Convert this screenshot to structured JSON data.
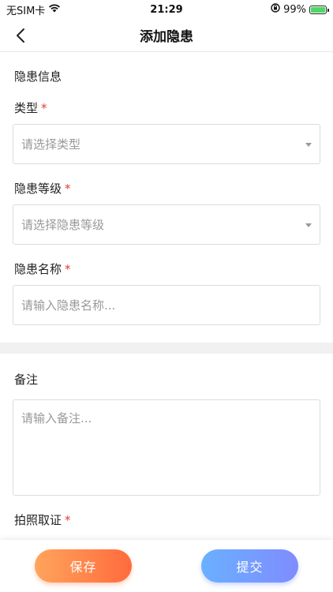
{
  "status_bar": {
    "carrier": "无SIM卡",
    "time": "21:29",
    "battery_percent": "99%",
    "battery_level": 0.99,
    "wifi_icon": "wifi-icon",
    "lock_icon": "orientation-lock-icon"
  },
  "nav": {
    "title": "添加隐患",
    "back_icon": "chevron-left-icon"
  },
  "form": {
    "section_title": "隐患信息",
    "type": {
      "label": "类型",
      "required_mark": "*",
      "placeholder": "请选择类型"
    },
    "level": {
      "label": "隐患等级",
      "required_mark": "*",
      "placeholder": "请选择隐患等级"
    },
    "name": {
      "label": "隐患名称",
      "required_mark": "*",
      "placeholder": "请输入隐患名称..."
    }
  },
  "remarks": {
    "title": "备注",
    "placeholder": "请输入备注..."
  },
  "evidence": {
    "label": "拍照取证",
    "required_mark": "*"
  },
  "actions": {
    "save_label": "保存",
    "submit_label": "提交"
  },
  "colors": {
    "required": "#e53935",
    "save_gradient_start": "#ffa45c",
    "save_gradient_end": "#ff6b3d",
    "submit_gradient_start": "#6ab0ff",
    "submit_gradient_end": "#7f8cff"
  }
}
